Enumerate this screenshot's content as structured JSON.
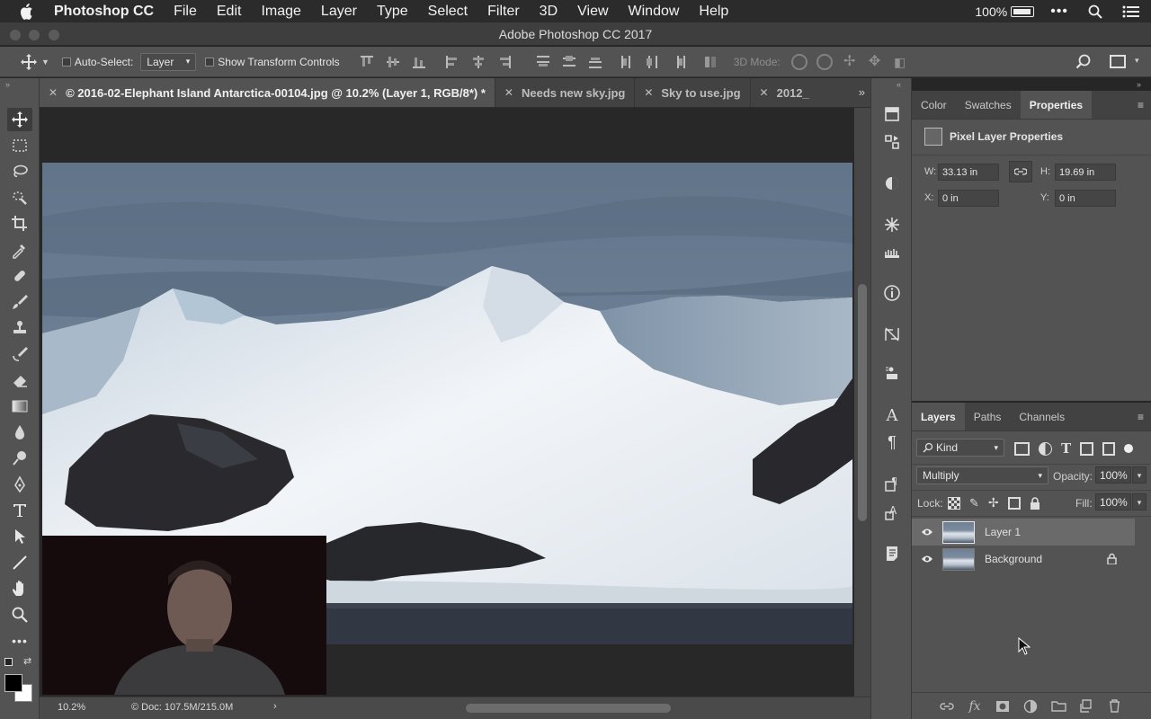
{
  "menubar": {
    "app_name": "Photoshop CC",
    "items": [
      "File",
      "Edit",
      "Image",
      "Layer",
      "Type",
      "Select",
      "Filter",
      "3D",
      "View",
      "Window",
      "Help"
    ],
    "battery": "100%"
  },
  "window": {
    "title": "Adobe Photoshop CC 2017"
  },
  "options": {
    "auto_select_label": "Auto-Select:",
    "auto_select_value": "Layer",
    "show_transform_label": "Show Transform Controls",
    "mode_3d_label": "3D Mode:"
  },
  "doc_tabs": [
    {
      "label": "© 2016-02-Elephant Island Antarctica-00104.jpg @ 10.2% (Layer 1, RGB/8*) *",
      "active": true
    },
    {
      "label": "Needs new sky.jpg",
      "active": false
    },
    {
      "label": "Sky to use.jpg",
      "active": false
    },
    {
      "label": "2012_",
      "active": false
    }
  ],
  "status": {
    "zoom": "10.2%",
    "doc": "© Doc: 107.5M/215.0M"
  },
  "properties_panel": {
    "tabs": [
      "Color",
      "Swatches",
      "Properties"
    ],
    "active_tab": "Properties",
    "header": "Pixel Layer Properties",
    "w_label": "W:",
    "w_value": "33.13 in",
    "h_label": "H:",
    "h_value": "19.69 in",
    "x_label": "X:",
    "x_value": "0 in",
    "y_label": "Y:",
    "y_value": "0 in"
  },
  "layers_panel": {
    "tabs": [
      "Layers",
      "Paths",
      "Channels"
    ],
    "active_tab": "Layers",
    "filter_label": "Kind",
    "blend_mode": "Multiply",
    "opacity_label": "Opacity:",
    "opacity_value": "100%",
    "lock_label": "Lock:",
    "fill_label": "Fill:",
    "fill_value": "100%",
    "layers": [
      {
        "name": "Layer 1",
        "visible": true,
        "selected": true,
        "locked": false
      },
      {
        "name": "Background",
        "visible": true,
        "selected": false,
        "locked": true
      }
    ]
  },
  "colors": {
    "foreground": "#000000",
    "background": "#ffffff",
    "accent": "#535353"
  }
}
